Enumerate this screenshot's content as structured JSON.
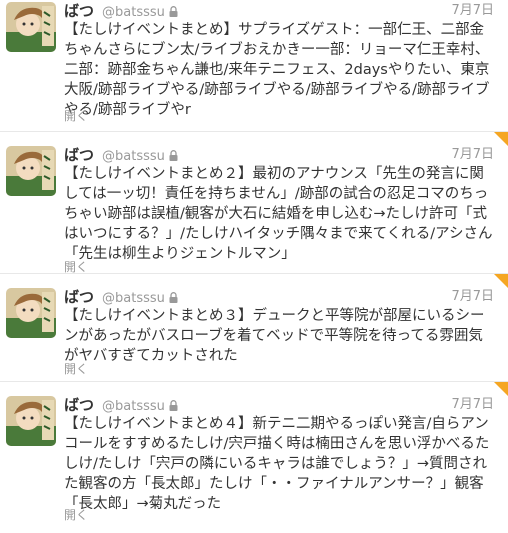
{
  "tweets": [
    {
      "name": "ばつ",
      "handle": "@batsssu",
      "time": "7月7日",
      "text": "【たしけイベントまとめ】サプライズゲスト：一部仁王、二部金ちゃんさらにブン太/ライブおえかきー一部：リョーマ仁王幸村、二部：跡部金ちゃん謙也/来年テニフェス、2daysやりたい、東京大阪/跡部ライブやる/跡部ライブやる/跡部ライブやる/跡部ライブやる/跡部ライブやr",
      "open": "開く",
      "favorited": false
    },
    {
      "name": "ばつ",
      "handle": "@batsssu",
      "time": "7月7日",
      "text": "【たしけイベントまとめ２】最初のアナウンス「先生の発言に関しては一ッ切！責任を持ちません」/跡部の試合の忍足コマのちっちゃい跡部は誤植/観客が大石に結婚を申し込む→たしけ許可「式はいつにする？」/たしけハイタッチ隅々まで来てくれる/アシさん「先生は柳生よりジェントルマン」",
      "open": "開く",
      "favorited": true
    },
    {
      "name": "ばつ",
      "handle": "@batsssu",
      "time": "7月7日",
      "text": "【たしけイベントまとめ３】デュークと平等院が部屋にいるシーンがあったがバスローブを着てベッドで平等院を待ってる雰囲気がヤバすぎてカットされた",
      "open": "開く",
      "favorited": true
    },
    {
      "name": "ばつ",
      "handle": "@batsssu",
      "time": "7月7日",
      "text": "【たしけイベントまとめ４】新テニ二期やるっぽい発言/自らアンコールをすすめるたしけ/宍戸描く時は楠田さんを思い浮かべるたしけ/たしけ「宍戸の隣にいるキャラは誰でしょう？」→質問された観客の方「長太郎」たしけ「・・ファイナルアンサー？」観客「長太郎」→菊丸だった",
      "open": "開く",
      "favorited": true
    }
  ],
  "colors": {
    "text": "#333333",
    "meta": "#999999",
    "divider": "#e8e8e8",
    "favorite_corner": "#f5a623"
  },
  "icons": {
    "lock": "lock-icon",
    "avatar": "avatar"
  }
}
